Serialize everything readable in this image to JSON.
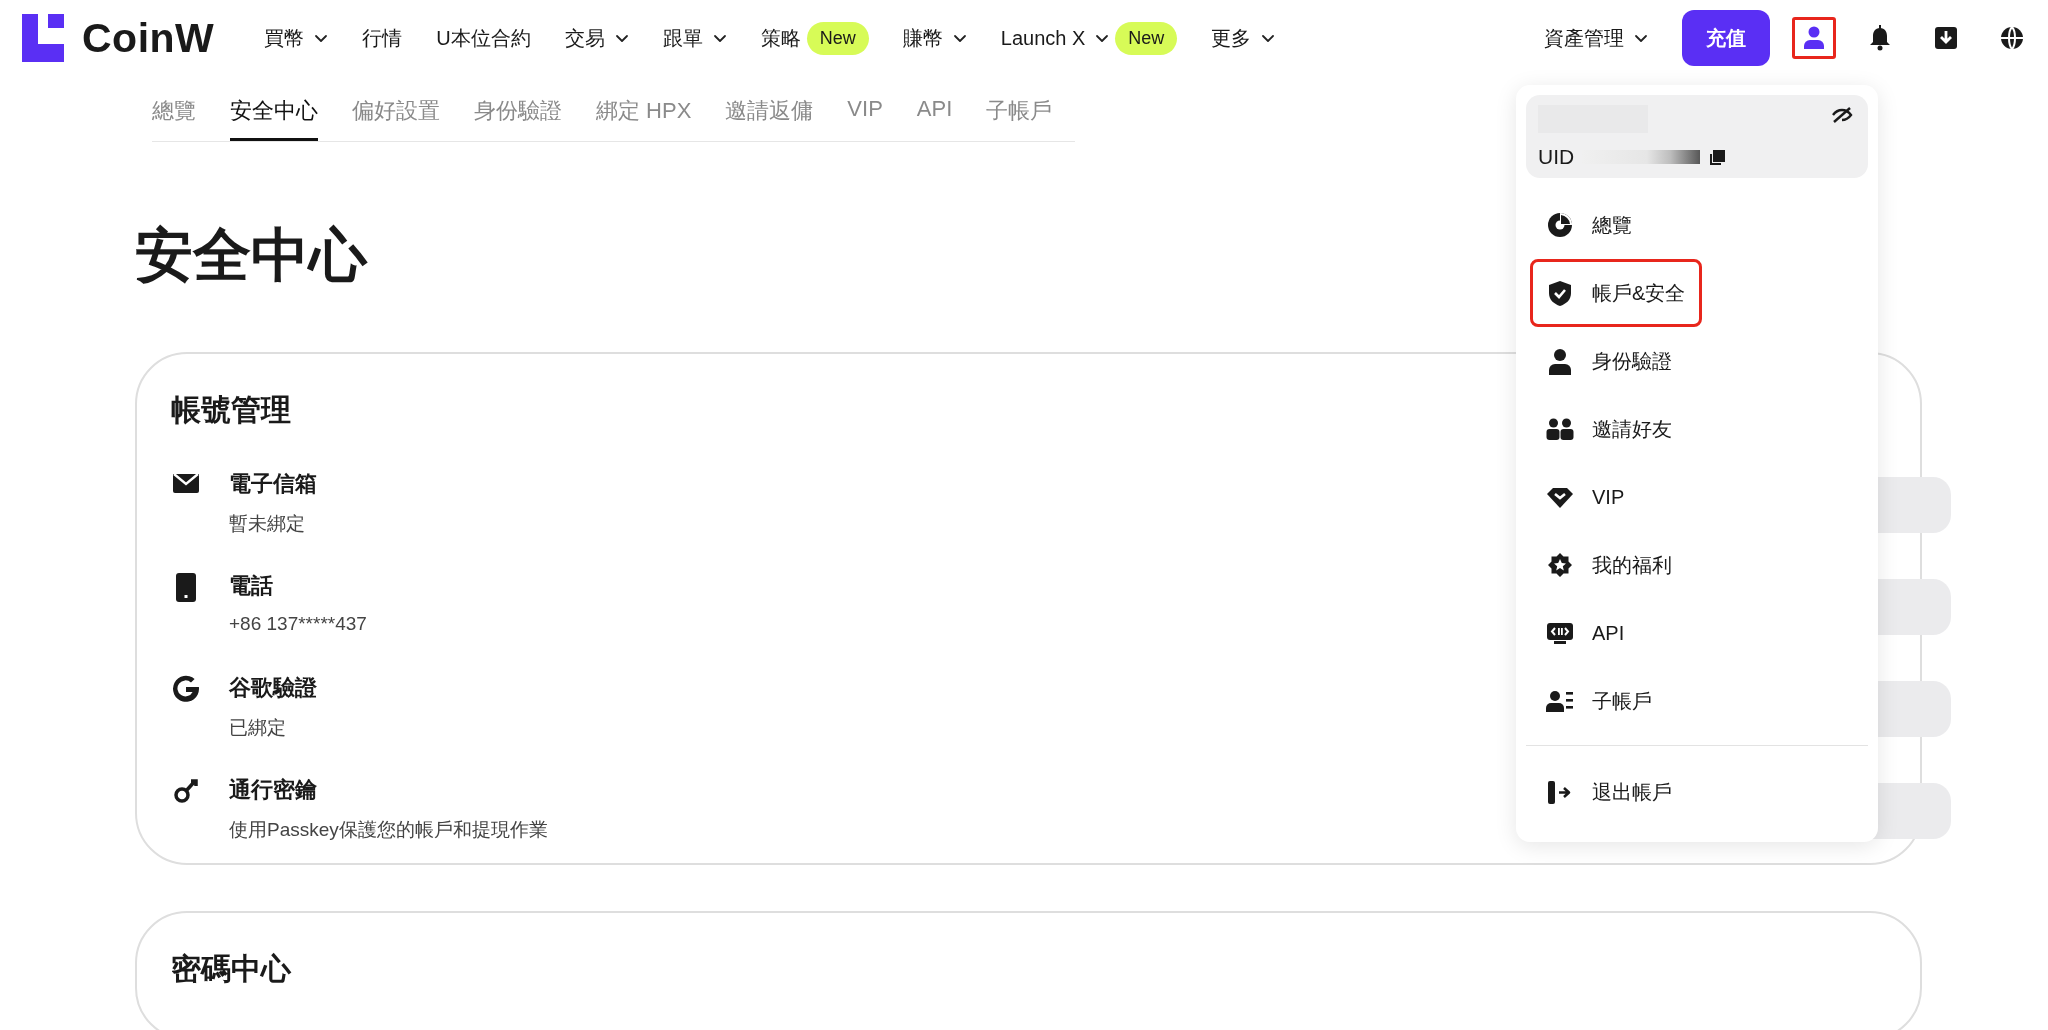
{
  "brand": {
    "name": "CoinW"
  },
  "nav": {
    "items": [
      {
        "label": "買幣",
        "dropdown": true
      },
      {
        "label": "行情",
        "dropdown": false
      },
      {
        "label": "U本位合約",
        "dropdown": false
      },
      {
        "label": "交易",
        "dropdown": true
      },
      {
        "label": "跟單",
        "dropdown": true
      },
      {
        "label": "策略",
        "dropdown": false,
        "badge": "New"
      },
      {
        "label": "賺幣",
        "dropdown": true
      },
      {
        "label": "Launch X",
        "dropdown": true,
        "badge": "New"
      },
      {
        "label": "更多",
        "dropdown": true
      }
    ],
    "assets": {
      "label": "資產管理",
      "dropdown": true
    },
    "deposit_button": "充值",
    "icons": [
      {
        "kind": "user",
        "highlighted": true
      },
      {
        "kind": "bell",
        "highlighted": false
      },
      {
        "kind": "download",
        "highlighted": false
      },
      {
        "kind": "globe",
        "highlighted": false
      }
    ]
  },
  "subtabs": [
    {
      "label": "總覽",
      "selected": false
    },
    {
      "label": "安全中心",
      "selected": true
    },
    {
      "label": "偏好設置",
      "selected": false
    },
    {
      "label": "身份驗證",
      "selected": false
    },
    {
      "label": "綁定 HPX",
      "selected": false
    },
    {
      "label": "邀請返傭",
      "selected": false
    },
    {
      "label": "VIP",
      "selected": false
    },
    {
      "label": "API",
      "selected": false
    },
    {
      "label": "子帳戶",
      "selected": false
    }
  ],
  "page_title": "安全中心",
  "cards": [
    {
      "title": "帳號管理",
      "rows": [
        {
          "label": "電子信箱",
          "detail": "暫未綁定"
        },
        {
          "label": "電話",
          "detail": "+86 137*****437"
        },
        {
          "label": "谷歌驗證",
          "detail": "已綁定"
        },
        {
          "label": "通行密鑰",
          "detail": "使用Passkey保護您的帳戶和提現作業"
        }
      ]
    },
    {
      "title": "密碼中心"
    }
  ],
  "account_menu": {
    "uid_label": "UID",
    "items": [
      {
        "label": "總覽",
        "highlighted": false
      },
      {
        "label": "帳戶&安全",
        "highlighted": true
      },
      {
        "label": "身份驗證",
        "highlighted": false
      },
      {
        "label": "邀請好友",
        "highlighted": false
      },
      {
        "label": "VIP",
        "highlighted": false
      },
      {
        "label": "我的福利",
        "highlighted": false
      },
      {
        "label": "API",
        "highlighted": false
      },
      {
        "label": "子帳戶",
        "highlighted": false
      }
    ],
    "logout": {
      "label": "退出帳戶",
      "highlighted": false
    }
  }
}
